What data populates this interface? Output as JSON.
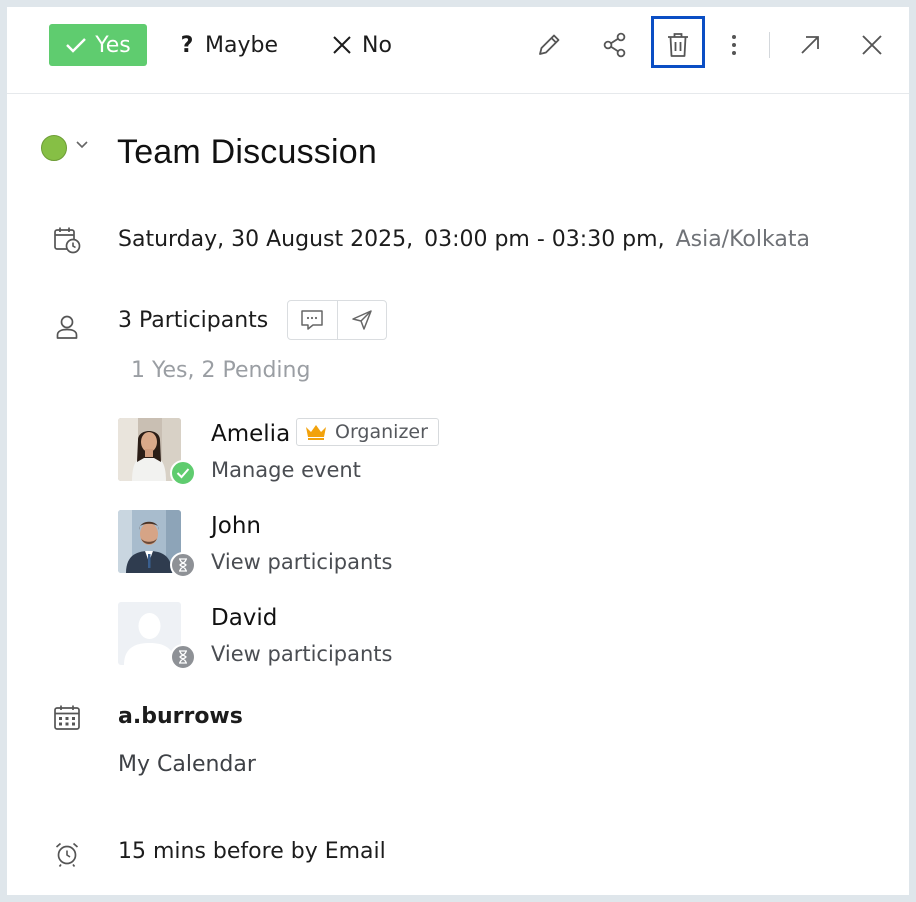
{
  "toolbar": {
    "rsvp_yes": "Yes",
    "rsvp_maybe": "Maybe",
    "rsvp_no": "No",
    "icons": [
      "edit-icon",
      "share-icon",
      "delete-icon",
      "more-icon",
      "open-external-icon",
      "close-icon"
    ],
    "highlighted_icon": "delete-icon",
    "accent_yes": "#5fcc6f",
    "highlight_color": "#0a4ec4"
  },
  "event": {
    "status_color": "#86bf45",
    "title": "Team Discussion",
    "date": "Saturday, 30 August 2025,",
    "time_range": "03:00 pm  - 03:30 pm,",
    "timezone": "Asia/Kolkata"
  },
  "participants": {
    "count_label": "3 Participants",
    "summary": "1 Yes, 2 Pending",
    "list": [
      {
        "name": "Amelia",
        "role": "Organizer",
        "action": "Manage event",
        "status": "yes"
      },
      {
        "name": "John",
        "action": "View participants",
        "status": "pending"
      },
      {
        "name": "David",
        "action": "View participants",
        "status": "pending"
      }
    ]
  },
  "calendar": {
    "owner": "a.burrows",
    "name": "My Calendar"
  },
  "reminder": {
    "text": "15 mins before by Email"
  }
}
